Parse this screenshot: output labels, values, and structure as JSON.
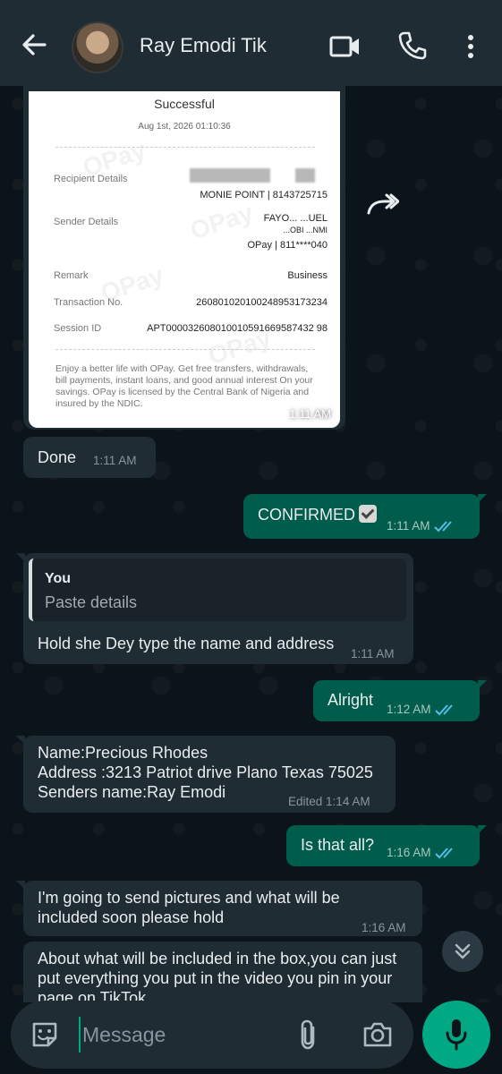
{
  "header": {
    "contact_name": "Ray Emodi Tik",
    "icons": [
      "back-arrow-icon",
      "video-call-icon",
      "phone-call-icon",
      "more-options-icon"
    ]
  },
  "receipt": {
    "status": "Successful",
    "datetime": "Aug 1st, 2026 01:10:36",
    "watermark": "OPay",
    "rows": [
      {
        "label": "Recipient Details",
        "value": "MONIE POINT | 8143725715"
      },
      {
        "label": "Sender Details",
        "value_line1": "FAYO... ...UEL",
        "value_line2": "...OBI ...NMI",
        "value_line3": "OPay | 811****040"
      },
      {
        "label": "Remark",
        "value": "Business"
      },
      {
        "label": "Transaction No.",
        "value": "260801020100248953173234"
      },
      {
        "label": "Session ID",
        "value": "APT000032608010010591669587432 98"
      }
    ],
    "footer": "Enjoy a better life with OPay. Get free transfers, withdrawals, bill payments, instant loans, and good annual interest On your savings. OPay is licensed by the Central Bank of Nigeria and insured by the NDIC.",
    "time": "1:11 AM"
  },
  "messages": [
    {
      "id": "m1",
      "direction": "incoming",
      "text": "Done",
      "time": "1:11 AM"
    },
    {
      "id": "m2",
      "direction": "outgoing",
      "text": "CONFIRMED",
      "time": "1:11 AM",
      "read": true
    },
    {
      "id": "m3",
      "direction": "incoming",
      "quote_author": "You",
      "quote_text": "Paste details",
      "text": "Hold she Dey type the name and address",
      "time": "1:11 AM"
    },
    {
      "id": "m4",
      "direction": "outgoing",
      "text": "Alright",
      "time": "1:12 AM",
      "read": true
    },
    {
      "id": "m5",
      "direction": "incoming",
      "lines": [
        "Name:Precious Rhodes",
        "Address :3213 Patriot drive Plano Texas 75025",
        "Senders name:Ray Emodi"
      ],
      "edited_label": "Edited",
      "time": "1:14 AM"
    },
    {
      "id": "m6",
      "direction": "outgoing",
      "text": "Is that all?",
      "time": "1:16 AM",
      "read": true
    },
    {
      "id": "m7",
      "direction": "incoming",
      "lines": [
        "I'm going to send pictures and what will be",
        "included soon please hold"
      ],
      "time": "1:16 AM"
    },
    {
      "id": "m8",
      "direction": "incoming",
      "lines": [
        "About what will be included in the box,you can just",
        "put everything you put in the video you pin in your",
        "page on TikTok"
      ]
    }
  ],
  "composer": {
    "placeholder": "Message"
  },
  "colors": {
    "background": "#0b141a",
    "header": "#1f2c34",
    "incoming_bubble": "#1f2c34",
    "outgoing_bubble": "#005c4b",
    "accent": "#00a884",
    "read_ticks": "#53bdeb"
  }
}
